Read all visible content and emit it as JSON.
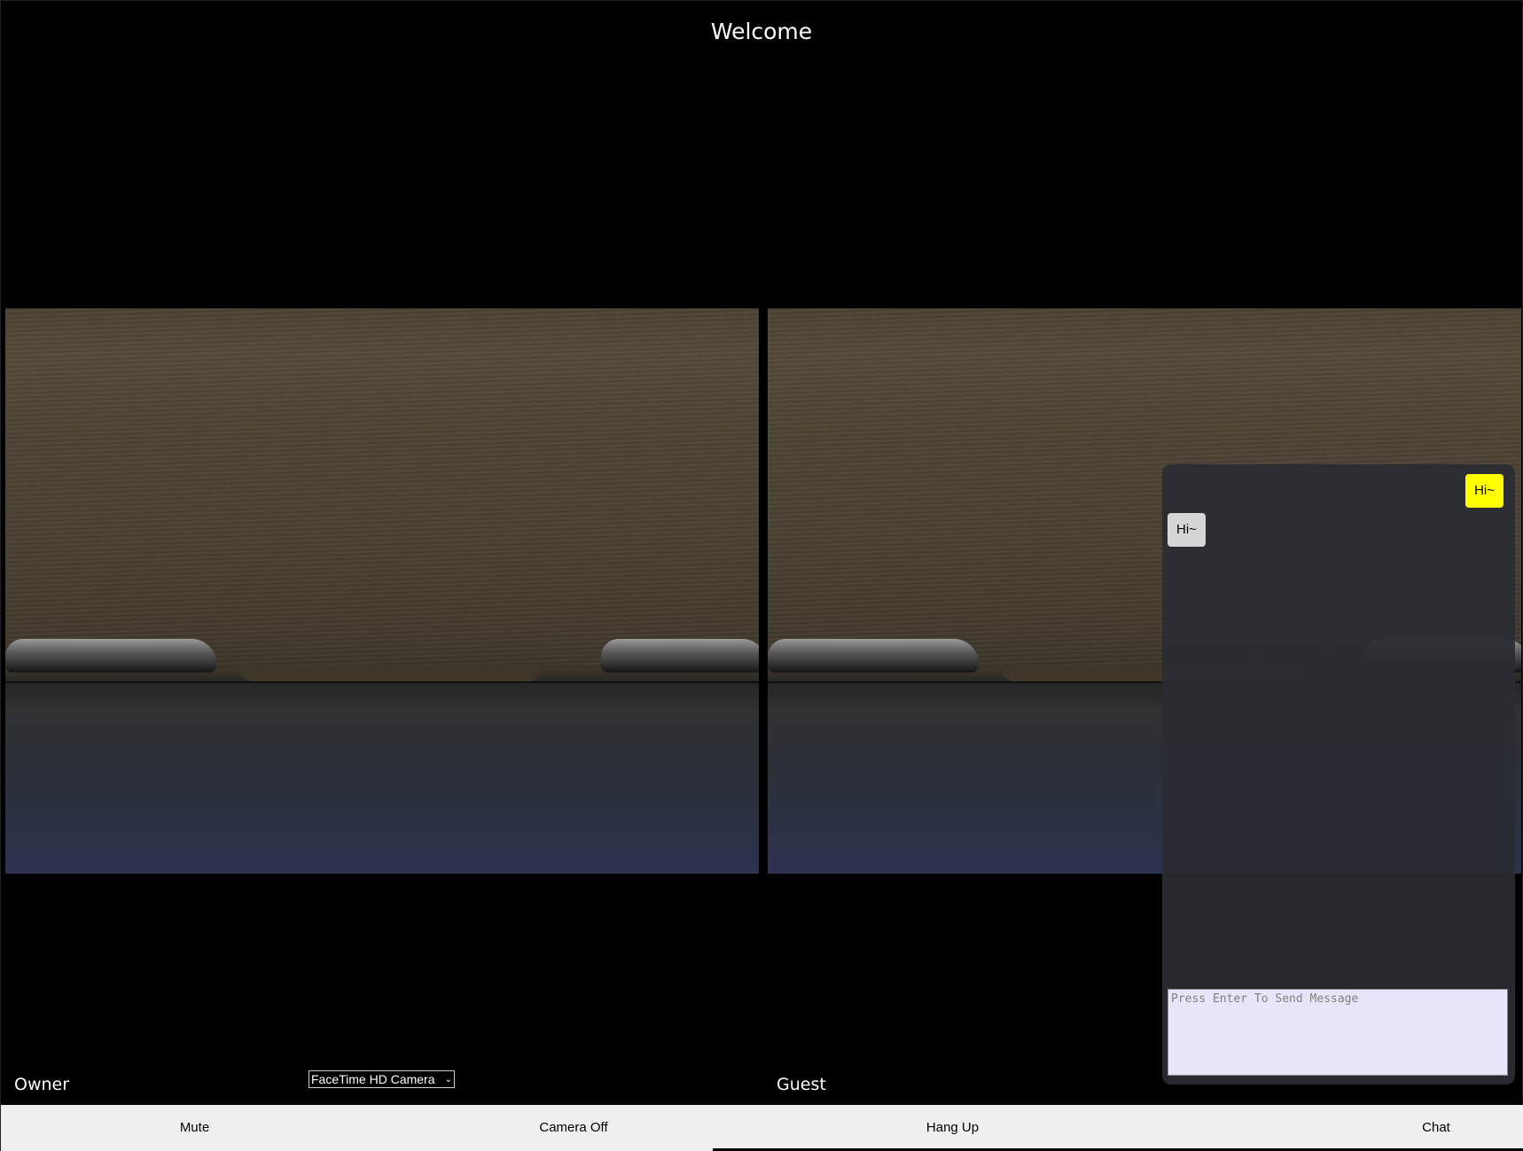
{
  "page": {
    "title": "Welcome"
  },
  "owner": {
    "label": "Owner",
    "camera_select": {
      "selected": "FaceTime HD Camera",
      "icon": "chevron-down-icon"
    }
  },
  "guest": {
    "label": "Guest"
  },
  "chat": {
    "messages": [
      {
        "sender": "me",
        "text": "Hi~"
      },
      {
        "sender": "other",
        "text": "Hi~"
      }
    ],
    "input": {
      "value": "",
      "placeholder": "Press Enter To Send Message"
    },
    "colors": {
      "panel": "#292c31",
      "mine": "#ffff00",
      "theirs": "#d6d6d6",
      "input": "#e6e6fa"
    }
  },
  "controls": {
    "mute": "Mute",
    "camera_off": "Camera Off",
    "hang_up": "Hang Up",
    "chat": "Chat"
  }
}
